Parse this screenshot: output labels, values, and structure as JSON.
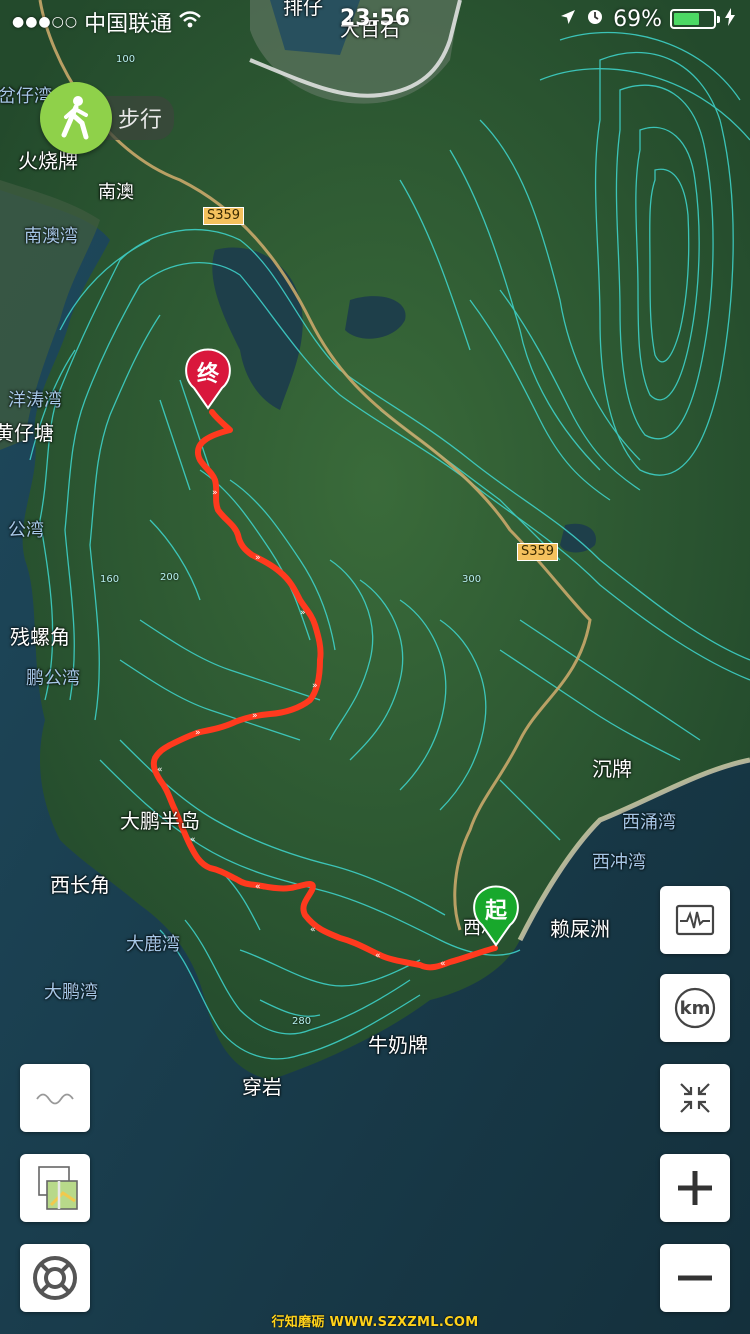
{
  "status_bar": {
    "carrier": "中国联通",
    "time": "23:56",
    "battery_percent": "69%",
    "battery_level": 0.69
  },
  "mode": {
    "label": "步行",
    "icon": "walking-person-icon"
  },
  "markers": {
    "start_label": "起",
    "end_label": "终",
    "start_color": "#18a82c",
    "end_color": "#d9173c"
  },
  "route": {
    "color": "#ff3a1e"
  },
  "map_labels": {
    "top_partial": "排仔",
    "dabaishi": "大百石",
    "cha_zai_wan": "岔仔湾",
    "huoshaopai": "火烧牌",
    "nanao": "南澳",
    "nanao_wan": "南澳湾",
    "yangtao_wan": "洋涛湾",
    "huangzaitang": "黄仔塘",
    "gong_wan": "公湾",
    "canluojiao": "残螺角",
    "penggong_wan": "鹏公湾",
    "dapeng_peninsula": "大鹏半岛",
    "xichangjiao": "西长角",
    "dalu_wan": "大鹿湾",
    "dapeng_wan": "大鹏湾",
    "chenpai": "沉牌",
    "xiyong_wan": "西涌湾",
    "xichong_wan": "西冲湾",
    "laishizhou": "赖屎洲",
    "xichong_partial": "西冲",
    "niunaipai": "牛奶牌",
    "chuanyan": "穿岩",
    "road_s359_north": "S359",
    "road_s359_east": "S359",
    "elev_100": "100",
    "elev_160": "160",
    "elev_200": "200",
    "elev_300": "300",
    "elev_280": "280"
  },
  "controls": {
    "elevation_profile": "elevation-chart-icon",
    "unit_toggle": "km",
    "collapse": "collapse-arrows-icon",
    "zoom_in": "plus-icon",
    "zoom_out": "minus-icon",
    "contour_toggle": "wave-line-icon",
    "layer_toggle": "map-layers-icon",
    "locate": "locate-target-icon"
  },
  "watermark": "行知磨砺 WWW.SZXZML.COM",
  "colors": {
    "contour": "#3fd8d0",
    "land": "#2f5a34",
    "sea": "#1c3f56",
    "mode_badge": "#8fd14a"
  }
}
